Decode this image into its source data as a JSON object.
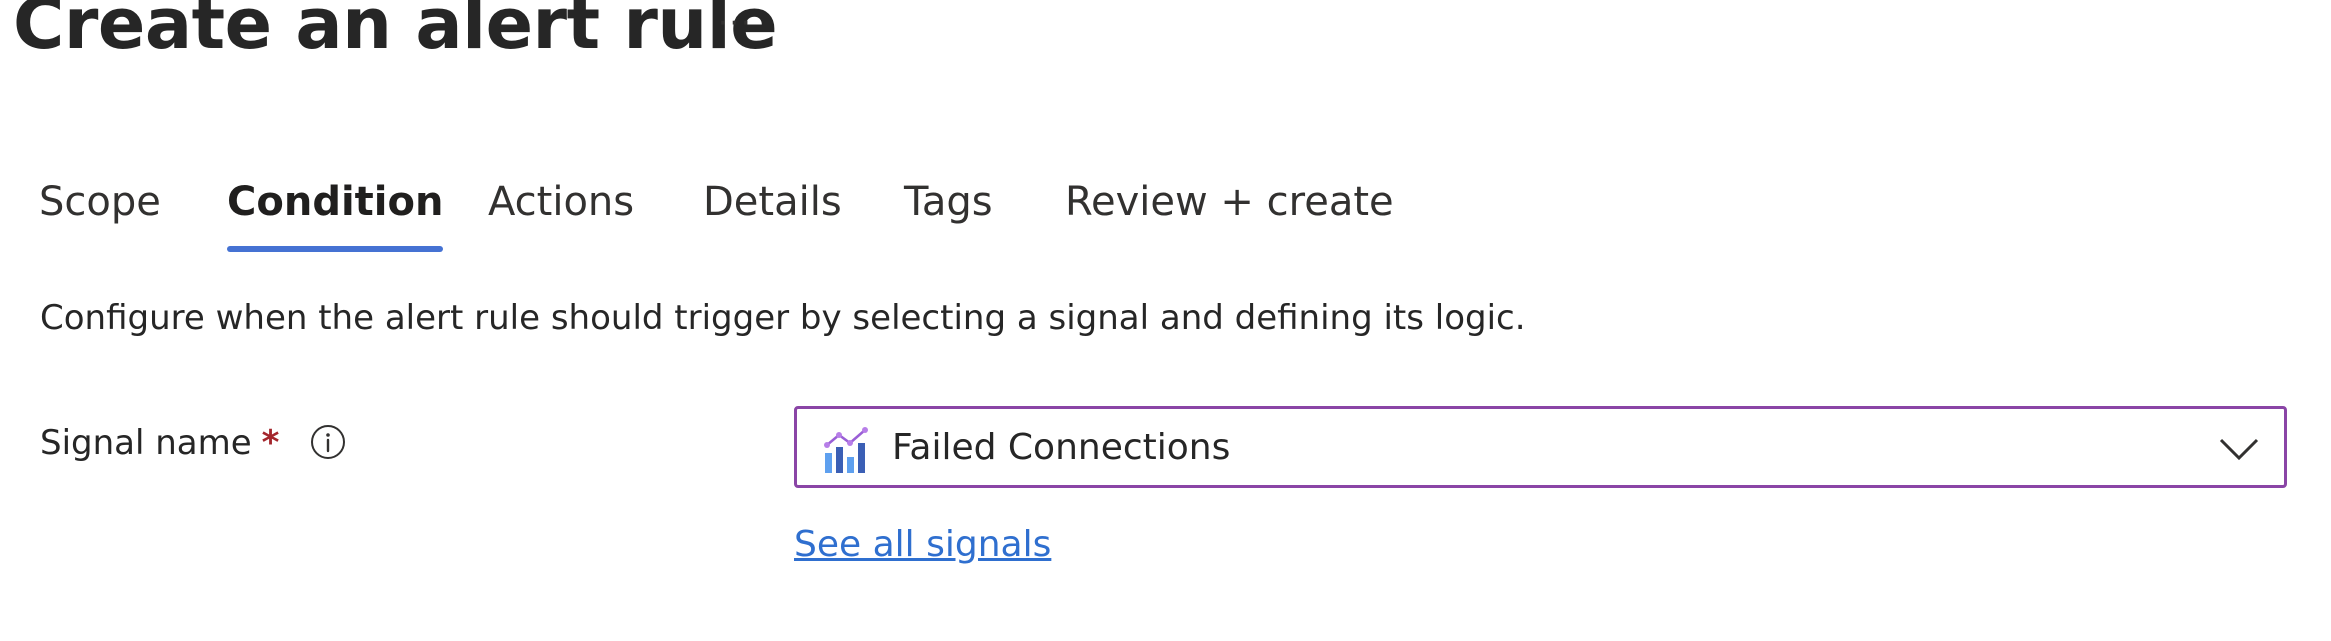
{
  "header": {
    "title": "Create an alert rule",
    "more_label": "···"
  },
  "tabs": [
    {
      "label": "Scope",
      "active": false
    },
    {
      "label": "Condition",
      "active": true
    },
    {
      "label": "Actions",
      "active": false
    },
    {
      "label": "Details",
      "active": false
    },
    {
      "label": "Tags",
      "active": false
    },
    {
      "label": "Review + create",
      "active": false
    }
  ],
  "condition": {
    "description": "Configure when the alert rule should trigger by selecting a signal and defining its logic.",
    "signal_name_label": "Signal name",
    "required_marker": "*",
    "signal_value": "Failed Connections",
    "see_all_link": "See all signals"
  },
  "colors": {
    "accent_tab_underline": "#4572d3",
    "dropdown_border": "#8a45a6",
    "link": "#2f6fcf",
    "required": "#a4262c"
  },
  "icons": {
    "more": "ellipsis-icon",
    "info": "info-icon",
    "signal": "metric-chart-icon",
    "dropdown": "chevron-down-icon"
  }
}
